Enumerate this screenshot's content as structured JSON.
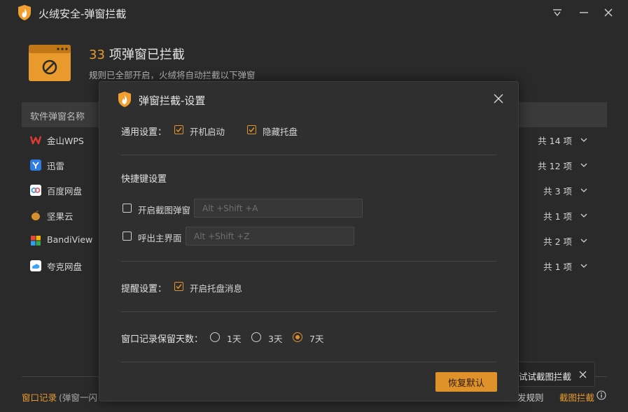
{
  "app": {
    "title": "火绒安全-弹窗拦截"
  },
  "header": {
    "count": "33",
    "title_suffix": "项弹窗已拦截",
    "subtitle": "规则已全部开启，火绒将自动拦截以下弹窗"
  },
  "list": {
    "column_header": "软件弹窗名称",
    "items": [
      {
        "name": "金山WPS",
        "count": "共 14 项",
        "icon": "wps-icon"
      },
      {
        "name": "迅雷",
        "count": "共 12 项",
        "icon": "xunlei-icon"
      },
      {
        "name": "百度网盘",
        "count": "共 3 项",
        "icon": "baidu-netdisk-icon"
      },
      {
        "name": "坚果云",
        "count": "共 1 项",
        "icon": "jianguoyun-icon"
      },
      {
        "name": "BandiView",
        "count": "共 2 项",
        "icon": "bandiview-icon"
      },
      {
        "name": "夸克网盘",
        "count": "共 1 项",
        "icon": "quark-netdisk-icon"
      }
    ]
  },
  "footer": {
    "window_log": "窗口记录",
    "window_log_note": "(弹窗一闪",
    "rule_partial": "发规则",
    "screenshot_block": "截图拦截"
  },
  "tip": {
    "text": "试试截图拦截"
  },
  "modal": {
    "title": "弹窗拦截-设置",
    "general": {
      "label": "通用设置：",
      "options": [
        {
          "label": "开机启动",
          "checked": true
        },
        {
          "label": "隐藏托盘",
          "checked": true
        }
      ]
    },
    "hotkeys": {
      "label": "快捷键设置",
      "items": [
        {
          "label": "开启截图弹窗",
          "checked": false,
          "placeholder": "Alt +Shift +A"
        },
        {
          "label": "呼出主界面",
          "checked": false,
          "placeholder": "Alt +Shift +Z"
        }
      ]
    },
    "reminder": {
      "label": "提醒设置：",
      "option": {
        "label": "开启托盘消息",
        "checked": true
      }
    },
    "retention": {
      "label": "窗口记录保留天数：",
      "options": [
        "1天",
        "3天",
        "7天"
      ],
      "selected": "7天"
    },
    "restore_label": "恢复默认"
  },
  "colors": {
    "accent": "#e0922a",
    "background": "#2a2a2a",
    "panel": "#2f2f2f"
  }
}
